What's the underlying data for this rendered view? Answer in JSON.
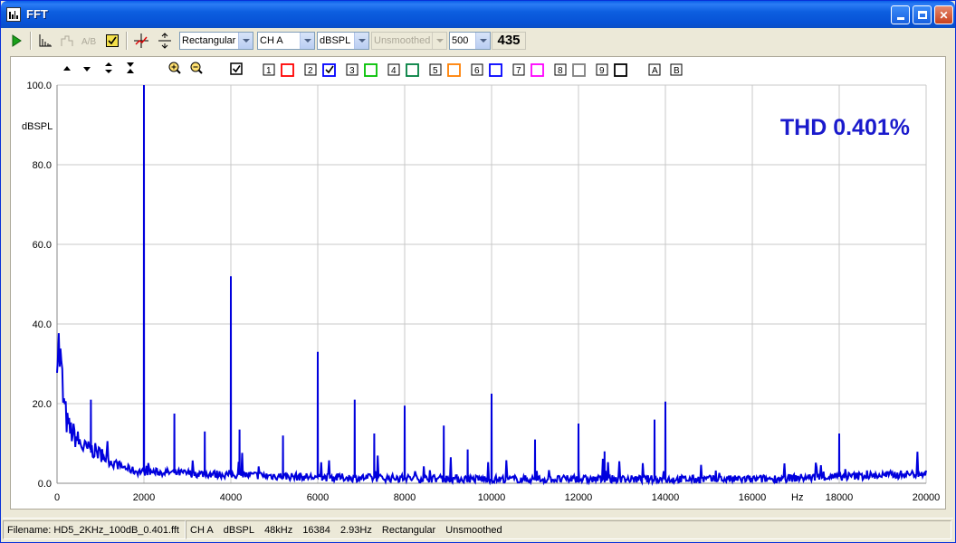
{
  "window": {
    "title": "FFT"
  },
  "toolbar": {
    "window_function": "Rectangular",
    "channel": "CH A",
    "unit": "dBSPL",
    "smoothing": "Unsmoothed",
    "points": "500",
    "count": "435"
  },
  "plot_toolbar": {
    "trace_numbers": [
      "1",
      "2",
      "3",
      "4",
      "5",
      "6",
      "7",
      "8",
      "9"
    ],
    "trace_colors": [
      "#ff0000",
      "#0000ff",
      "#00c000",
      "#008040",
      "#ff8000",
      "#0000ff",
      "#ff00ff",
      "#808080",
      "#000000"
    ],
    "trace_checked": [
      false,
      true,
      false,
      false,
      false,
      false,
      false,
      false,
      false
    ],
    "cursor_a": "A",
    "cursor_b": "B"
  },
  "annotation": {
    "thd": "THD 0.401%"
  },
  "status": {
    "filename": "Filename: HD5_2KHz_100dB_0.401.fft",
    "channel": "CH A",
    "unit": "dBSPL",
    "sample_rate": "48kHz",
    "fft_size": "16384",
    "resolution": "2.93Hz",
    "window": "Rectangular",
    "smoothing": "Unsmoothed"
  },
  "chart_data": {
    "type": "line",
    "ylabel": "dBSPL",
    "xlabel": "Hz",
    "xlim": [
      0,
      20000
    ],
    "ylim": [
      0,
      100
    ],
    "x_ticks": [
      "0",
      "2000",
      "4000",
      "6000",
      "8000",
      "10000",
      "12000",
      "14000",
      "16000",
      "18000",
      "20000"
    ],
    "y_ticks": [
      "0.0",
      "20.0",
      "40.0",
      "60.0",
      "80.0",
      "100.0"
    ],
    "grid": true,
    "series_color": "#0000dd",
    "peaks": [
      {
        "x": 2000,
        "y": 100.0
      },
      {
        "x": 4000,
        "y": 52.0
      },
      {
        "x": 6000,
        "y": 33.0
      },
      {
        "x": 6850,
        "y": 21.0
      },
      {
        "x": 8000,
        "y": 19.5
      },
      {
        "x": 10000,
        "y": 22.5
      },
      {
        "x": 12000,
        "y": 15.0
      },
      {
        "x": 14000,
        "y": 20.5
      },
      {
        "x": 13750,
        "y": 16.0
      },
      {
        "x": 18000,
        "y": 12.5
      },
      {
        "x": 780,
        "y": 21.0
      },
      {
        "x": 2700,
        "y": 17.5
      },
      {
        "x": 3400,
        "y": 13.0
      },
      {
        "x": 4200,
        "y": 13.5
      },
      {
        "x": 5200,
        "y": 12.0
      },
      {
        "x": 7300,
        "y": 12.5
      },
      {
        "x": 8900,
        "y": 14.5
      },
      {
        "x": 9450,
        "y": 8.5
      },
      {
        "x": 11000,
        "y": 11.0
      },
      {
        "x": 12600,
        "y": 8.0
      }
    ],
    "low_freq": [
      {
        "x": 0,
        "y": 37
      },
      {
        "x": 50,
        "y": 33
      },
      {
        "x": 100,
        "y": 28
      },
      {
        "x": 150,
        "y": 20
      },
      {
        "x": 250,
        "y": 14
      },
      {
        "x": 400,
        "y": 12
      },
      {
        "x": 600,
        "y": 9
      },
      {
        "x": 900,
        "y": 8
      },
      {
        "x": 1300,
        "y": 5
      },
      {
        "x": 1800,
        "y": 3
      },
      {
        "x": 3000,
        "y": 2.5
      },
      {
        "x": 6000,
        "y": 1.5
      },
      {
        "x": 10000,
        "y": 1
      },
      {
        "x": 16000,
        "y": 1
      },
      {
        "x": 19000,
        "y": 2
      },
      {
        "x": 20000,
        "y": 2.5
      }
    ]
  }
}
